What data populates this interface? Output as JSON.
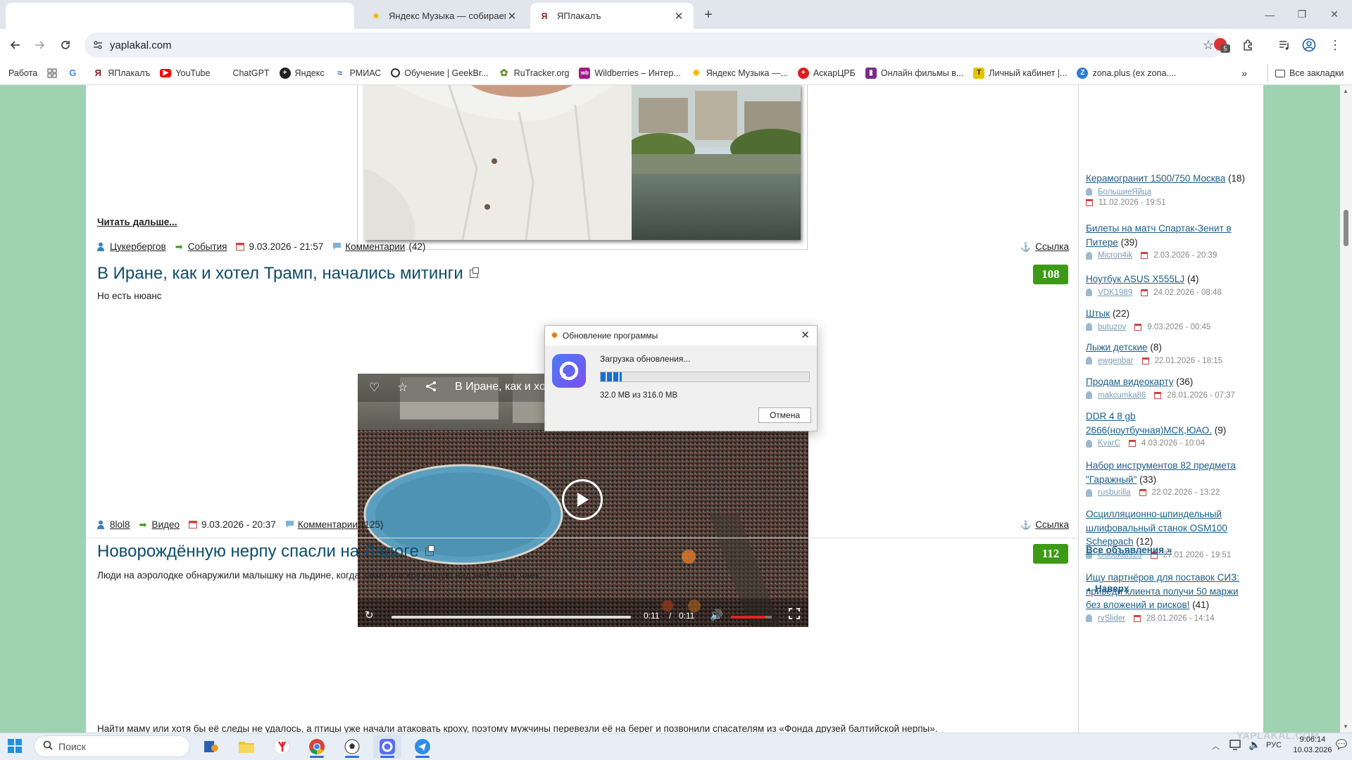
{
  "browser": {
    "tabs": [
      {
        "title": "",
        "icon": "blank-tab",
        "active": false
      },
      {
        "title": "Яндекс Музыка — собираем м",
        "icon": "yandex-music-icon",
        "active": false
      },
      {
        "title": "ЯПлакалъ",
        "icon": "yaplakal-icon",
        "active": true
      }
    ],
    "new_tab_label": "+",
    "url": "yaplakal.com",
    "bookmarks": [
      {
        "label": "Работа",
        "icon": "",
        "color": ""
      },
      {
        "label": "",
        "icon": "apps-grid-icon",
        "color": ""
      },
      {
        "label": "",
        "icon": "google-icon",
        "color": "#4285f4"
      },
      {
        "label": "ЯПлакалъ",
        "icon": "yaplakal-icon",
        "color": "#8b1a1a"
      },
      {
        "label": "YouTube",
        "icon": "youtube-icon",
        "color": "#ff0000"
      },
      {
        "label": "ChatGPT",
        "icon": "",
        "color": ""
      },
      {
        "label": "Яндекс",
        "icon": "yandex-icon",
        "color": "#222222"
      },
      {
        "label": "РМИАС",
        "icon": "rmias-icon",
        "color": "#2a6cb8"
      },
      {
        "label": "Обучение | GeekBr...",
        "icon": "geekbrains-icon",
        "color": "#333333"
      },
      {
        "label": "RuTracker.org",
        "icon": "rutracker-icon",
        "color": "#6b8e23"
      },
      {
        "label": "Wildberries – Интер...",
        "icon": "wildberries-icon",
        "color": "#a21a8a"
      },
      {
        "label": "Яндекс Музыка —...",
        "icon": "yandex-music-icon",
        "color": "#f5b700"
      },
      {
        "label": "АскарЦРБ",
        "icon": "askar-icon",
        "color": "#d62020"
      },
      {
        "label": "Онлайн фильмы в...",
        "icon": "films-icon",
        "color": "#7a2a8a"
      },
      {
        "label": "Личный кабинет |...",
        "icon": "cabinet-icon",
        "color": "#e6c200"
      },
      {
        "label": "zona.plus (ex zona....",
        "icon": "zona-icon",
        "color": "#2d7bd6"
      }
    ],
    "all_bookmarks_label": "Все закладки",
    "extension_badge": "5"
  },
  "article1": {
    "read_more": "Читать дальше...",
    "author": "Цукербергов",
    "category": "События",
    "date": "9.03.2026 - 21:57",
    "comments_label": "Комментарии",
    "comments_count": "(42)",
    "link_label": "Ссылка"
  },
  "article2": {
    "title": "В Иране, как и хотел Трамп, начались митинги",
    "score": "108",
    "subtitle": "Но есть нюанс",
    "video_title": "В Иране, как и хо",
    "time_current": "0:11",
    "time_sep": "/",
    "time_total": "0:11",
    "progress": 1.0,
    "volume": 0.85,
    "author": "8lol8",
    "category": "Видео",
    "date": "9.03.2026 - 20:37",
    "comments_label": "Комментарии",
    "comments_count": "(125)",
    "link_label": "Ссылка"
  },
  "article3": {
    "title": "Новорождённую нерпу спасли на Ладоге",
    "score": "112",
    "text1": "Люди на аэролодке обнаружили малышку на льдине, когда заметили кружащую над ней толпу чаек.",
    "text2": "Найти маму или хотя бы её следы не удалось, а птицы уже начали атаковать кроху, поэтому мужчины перевезли её на берег и позвонили спасателям из «Фонда друзей балтийской нерпы»."
  },
  "sidebar": {
    "ads": [
      {
        "title": "Керамогранит 1500/750 Москва",
        "count": "(18)",
        "user": "БольшиеЯйца",
        "date": "11.02.2026 - 19:51",
        "date_newline": true
      },
      {
        "title": "Билеты на матч Спартак-Зенит в Питере",
        "count": "(39)",
        "user": "Micron4ik",
        "date": "2.03.2026 - 20:39",
        "date_newline": false
      },
      {
        "title": "Ноутбук ASUS X555LJ",
        "count": "(4)",
        "user": "VDK1989",
        "date": "24.02.2026 - 08:48",
        "date_newline": false
      },
      {
        "title": "Штык",
        "count": "(22)",
        "user": "butuzov",
        "date": "9.03.2026 - 00:45",
        "date_newline": false
      },
      {
        "title": "Лыжи детские",
        "count": "(8)",
        "user": "ewgenbar",
        "date": "22.01.2026 - 18:15",
        "date_newline": false
      },
      {
        "title": "Продам видеокарту",
        "count": "(36)",
        "user": "makcumka86",
        "date": "28.01.2026 - 07:37",
        "date_newline": false
      },
      {
        "title": "DDR 4 8 gb 2666(ноутбучная)МСК,ЮАО.",
        "count": "(9)",
        "user": "KvarC",
        "date": "4.03.2026 - 10:04",
        "date_newline": false
      },
      {
        "title": "Набор инструментов 82 предмета \"Гаражный\"",
        "count": "(33)",
        "user": "rusburilla",
        "date": "22.02.2026 - 13:22",
        "date_newline": false
      },
      {
        "title": "Осцилляционно-шпиндельный шлифовальный станок OSM100 Scheppach",
        "count": "(12)",
        "user": "Goodkat923",
        "date": "27.01.2026 - 19:51",
        "date_newline": false
      },
      {
        "title": "Ищу партнёров для поставок СИЗ: приведи клиента получи 50 маржи без вложений и рисков!",
        "count": "(41)",
        "user": "rvSlider",
        "date": "28.01.2026 - 14:14",
        "date_newline": false
      }
    ],
    "all_ads": "Все объявления »",
    "to_top": "Наверх"
  },
  "dialog": {
    "title": "Обновление программы",
    "status": "Загрузка обновления...",
    "progress_text": "32.0 MB из 316.0 MB",
    "progress": 0.101,
    "cancel_label": "Отмена"
  },
  "taskbar": {
    "search_placeholder": "Поиск",
    "lang": "РУС",
    "time": "9:06:14",
    "date": "10.03.2026",
    "watermark": "YAPLAKAL.COM"
  },
  "colors": {
    "page_bg": "#9ed2b0",
    "headline": "#0d4c6a",
    "score_bg": "#3d9a16",
    "link": "#1b5e89",
    "progress": "#1a6fd0"
  }
}
